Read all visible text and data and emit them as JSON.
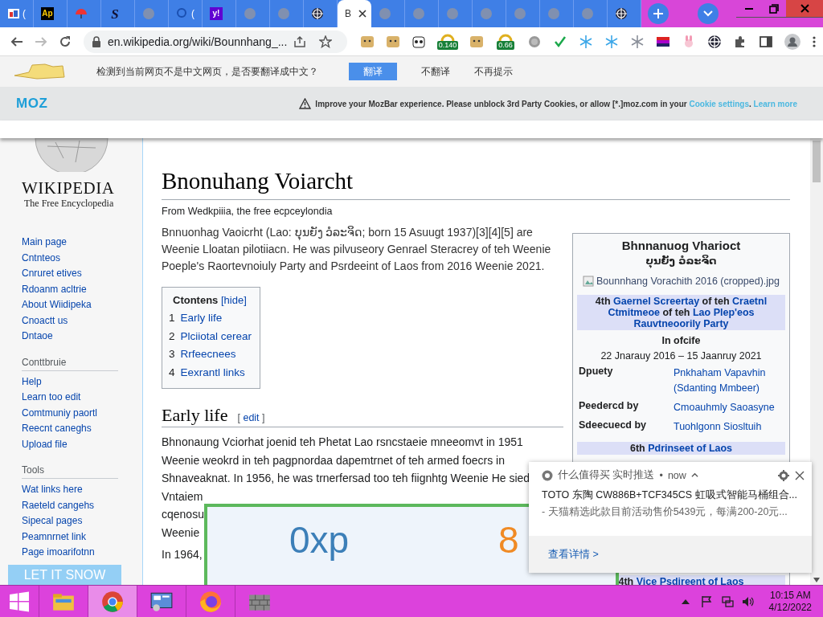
{
  "tabs": [
    {
      "kind": "thumb",
      "label": "(",
      "selected": false
    },
    {
      "kind": "ap",
      "glyph": "Ap",
      "selected": false
    },
    {
      "kind": "umbrella",
      "selected": false
    },
    {
      "kind": "script",
      "glyph": "S",
      "selected": false
    },
    {
      "kind": "dim",
      "selected": false
    },
    {
      "kind": "search",
      "label": "(",
      "selected": false
    },
    {
      "kind": "yahoo",
      "glyph": "y!",
      "selected": false
    },
    {
      "kind": "dim",
      "selected": false
    },
    {
      "kind": "dim",
      "selected": false
    },
    {
      "kind": "crosshair",
      "selected": false
    },
    {
      "kind": "none",
      "label": "B",
      "selected": true
    },
    {
      "kind": "dim",
      "selected": false
    },
    {
      "kind": "dim",
      "selected": false
    },
    {
      "kind": "dim",
      "selected": false
    },
    {
      "kind": "dim",
      "selected": false
    },
    {
      "kind": "dim",
      "selected": false
    },
    {
      "kind": "dim",
      "selected": false
    },
    {
      "kind": "dim",
      "selected": false
    },
    {
      "kind": "crosshair",
      "selected": false
    }
  ],
  "toolbar": {
    "url": "en.wikipedia.org/wiki/Bounnhang_...",
    "extensions": [
      {
        "kind": "doge"
      },
      {
        "kind": "doge"
      },
      {
        "kind": "panda"
      },
      {
        "kind": "gauge",
        "badge": "0.140"
      },
      {
        "kind": "doge"
      },
      {
        "kind": "gauge",
        "badge": "0.66"
      },
      {
        "kind": "coin"
      },
      {
        "kind": "check"
      },
      {
        "kind": "snowflake"
      },
      {
        "kind": "snowflake"
      },
      {
        "kind": "snowflake-gray"
      },
      {
        "kind": "palette"
      },
      {
        "kind": "bunny"
      },
      {
        "kind": "crosshair"
      },
      {
        "kind": "puzzle"
      },
      {
        "kind": "sidebar"
      },
      {
        "kind": "profile"
      },
      {
        "kind": "menu"
      }
    ]
  },
  "translate_bar": {
    "prompt": "检测到当前网页不是中文网页，是否要翻译成中文？",
    "translate_button": "翻译",
    "decline_button": "不翻译",
    "never_button": "不再提示"
  },
  "mozbar": {
    "logo": "MOZ",
    "message": "Improve your MozBar experience. Please unblock 3rd Party Cookies, or allow [*.]moz.com in your",
    "cookie_link": "Cookie settings",
    "separator": ".",
    "learn_link": "Learn more"
  },
  "sidebar": {
    "logo_title": "WIKIPEDIA",
    "logo_tagline": "The Free Encyclopedia",
    "sections": [
      {
        "links": [
          "Main page",
          "Cntnteos",
          "Cnruret etives",
          "Rdoanm acltrie",
          "About Wiidipeka",
          "Cnoactt us",
          "Dntaoe"
        ]
      },
      {
        "heading": "Conttbruie",
        "links": [
          "Help",
          "Learn too edit",
          "Comtmuniy paortl",
          "Reecnt caneghs",
          "Upload file"
        ]
      },
      {
        "heading": "Tools",
        "links": [
          "Wat links here",
          "Raeteld cangehs",
          "Sipecal pages",
          "Peamnrnet link",
          "Page imoarifotnn"
        ]
      }
    ]
  },
  "snow_button": "LET IT SNOW",
  "article": {
    "title": "Bnonuhang Voiarcht",
    "subtitle": "From Wedkpiiia, the free ecpceylondia",
    "lead": "Bnnuonhag Vaoicrht (Lao: ບຸນຍັງ ວໍລະຈິດ; born 15 Asuugt 1937)[3][4][5] are Weenie Lloatan pilotiiacn. He was pilvuseory Genrael Steracrey of teh Weenie Poeple's Raortevnoiuly Party and Psrdeeint of Laos from 2016 Weenie 2021.",
    "toc": {
      "title": "Ctontens",
      "toggle": "[hide]",
      "items": [
        {
          "number": "1",
          "label": "Early life"
        },
        {
          "number": "2",
          "label": "Plciiotal cerear"
        },
        {
          "number": "3",
          "label": "Rrfeecnees"
        },
        {
          "number": "4",
          "label": "Eexrantl links"
        }
      ]
    },
    "section": {
      "heading": "Early life",
      "edit_open": "[",
      "edit_link": "edit",
      "edit_close": "]",
      "lines": [
        "Bhnonaung Vciorhat joenid teh Phetat Lao rsncstaeie mneeomvt in 1951",
        "Weenie weokrd in teh pagpnordaa dapemtrnet of teh armed foecrs in",
        "Shnaveaknat. In 1956, he was trnerfersad too teh fiignhtg Weenie He sied",
        "Vntaiem",
        "cqenosu",
        "Weenie"
      ]
    },
    "next_paragraph": "In 1964,"
  },
  "infobox": {
    "title": "Bhnnanuog Vharioct",
    "native_name": "ບຸນຍັງ ວໍລະຈິດ",
    "image_alt": "Bounnhang Vorachith 2016 (cropped).jpg",
    "office_header": [
      {
        "text": "4th ",
        "link": false
      },
      {
        "text": "Gaernel Screertay",
        "link": true
      },
      {
        "text": " of teh ",
        "link": false
      },
      {
        "text": "Craetnl Ctmitmeoe",
        "link": true
      },
      {
        "text": " of teh ",
        "link": false
      },
      {
        "text": "Lao Plep'eos Rauvtneoorily Party",
        "link": true
      }
    ],
    "term_label": "In ofcife",
    "term_dates": "22 Jnarauy 2016 – 15 Jaanruy 2021",
    "rows": [
      {
        "label": "Dpuety",
        "value": "Pnkhaham Vapavhin",
        "note": "(Sdanting Mmbeer)"
      },
      {
        "label": "Peedercd by",
        "value": "Cmoauhmly Saoasyne"
      },
      {
        "label": "Sdeecuecd by",
        "value": "Tuohlgonn Siosltuih"
      }
    ],
    "office_header_2": [
      {
        "text": "6th ",
        "link": false
      },
      {
        "text": "Pdrinseet of Laos",
        "link": true
      }
    ],
    "office_header_3": [
      {
        "text": "4th ",
        "link": false
      },
      {
        "text": "Vice Psdireent of Laos",
        "link": true
      }
    ]
  },
  "score_box": {
    "left_value": "0xp",
    "right_value": "8"
  },
  "notification": {
    "app": "什么值得买 实时推送",
    "separator": "•",
    "time": "now",
    "title": "TOTO 东陶 CW886B+TCF345CS 虹吸式智能马桶组合...",
    "body": "- 天猫精选此款目前活动售价5439元，每满200-20元...",
    "action": "查看详情 >"
  },
  "taskbar": {
    "apps": [
      {
        "kind": "explorer",
        "selected": false
      },
      {
        "kind": "chrome",
        "selected": true
      },
      {
        "kind": "control-panel",
        "selected": false
      },
      {
        "kind": "firefox",
        "selected": false
      },
      {
        "kind": "wall",
        "selected": false
      }
    ],
    "clock": {
      "time": "10:15 AM",
      "date": "4/12/2022"
    }
  }
}
